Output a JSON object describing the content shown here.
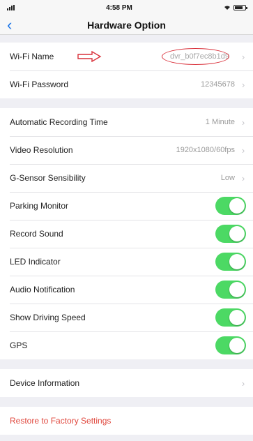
{
  "status_bar": {
    "time": "4:58 PM"
  },
  "nav": {
    "title": "Hardware Option",
    "back_icon": "chevron-left-icon"
  },
  "wifi": {
    "name_label": "Wi-Fi Name",
    "name_value": "dvr_b0f7ec8b1d9",
    "password_label": "Wi-Fi Password",
    "password_value": "12345678"
  },
  "recording": {
    "auto_time_label": "Automatic Recording Time",
    "auto_time_value": "1 Minute",
    "resolution_label": "Video Resolution",
    "resolution_value": "1920x1080/60fps",
    "gsensor_label": "G-Sensor Sensibility",
    "gsensor_value": "Low"
  },
  "toggles": [
    {
      "label": "Parking Monitor",
      "on": true
    },
    {
      "label": "Record Sound",
      "on": true
    },
    {
      "label": "LED Indicator",
      "on": true
    },
    {
      "label": "Audio Notification",
      "on": true
    },
    {
      "label": "Show Driving Speed",
      "on": true
    },
    {
      "label": "GPS",
      "on": true
    }
  ],
  "device": {
    "info_label": "Device Information"
  },
  "restore": {
    "label": "Restore to Factory Settings"
  },
  "colors": {
    "accent": "#1a74e8",
    "toggle_on": "#4cd964",
    "danger": "#e0483e",
    "annotation": "#d9303a"
  }
}
